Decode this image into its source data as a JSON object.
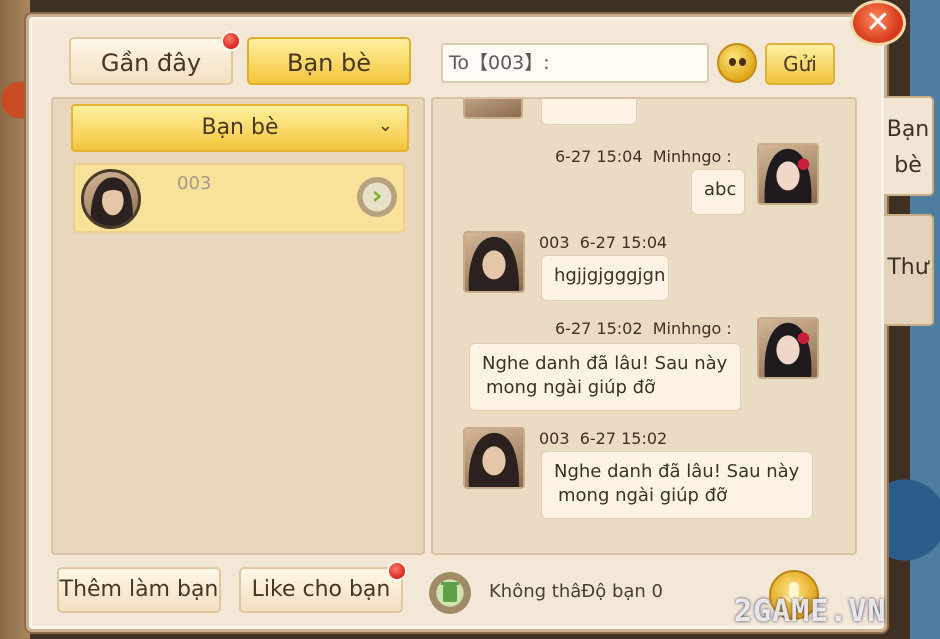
{
  "tabs": {
    "recent": "Gần đây",
    "friends": "Bạn bè"
  },
  "compose": {
    "to_label": "To【003】:",
    "send_label": "Gửi"
  },
  "friend_list": {
    "group_label": "Bạn bè",
    "friends": [
      {
        "name": "003"
      }
    ]
  },
  "chat": {
    "messages": [
      {
        "timestamp": "6-27 15:04",
        "sender": "Minhngo :",
        "text": "abc"
      },
      {
        "sender": "003",
        "timestamp": "6-27 15:04",
        "text": "hgjjgjgggjgn"
      },
      {
        "timestamp": "6-27 15:02",
        "sender": "Minhngo :",
        "line1": "Nghe danh đã lâu! Sau này",
        "line2": "mong ngài giúp đỡ"
      },
      {
        "sender": "003",
        "timestamp": "6-27 15:02",
        "line1": "Nghe danh đã lâu! Sau này",
        "line2": "mong ngài giúp đỡ"
      }
    ]
  },
  "bottom": {
    "add_friend": "Thêm làm bạn",
    "like_friend": "Like cho bạn",
    "status": "Không thâĐộ bạn 0"
  },
  "side_tabs": {
    "friends_line1": "Bạn",
    "friends_line2": "bè",
    "mail": "Thư"
  },
  "watermark": "2GAME.VN",
  "colors": {
    "accent_yellow": "#f3c63a",
    "panel_bg": "#f3e7d8",
    "badge_red": "#d8251d"
  }
}
